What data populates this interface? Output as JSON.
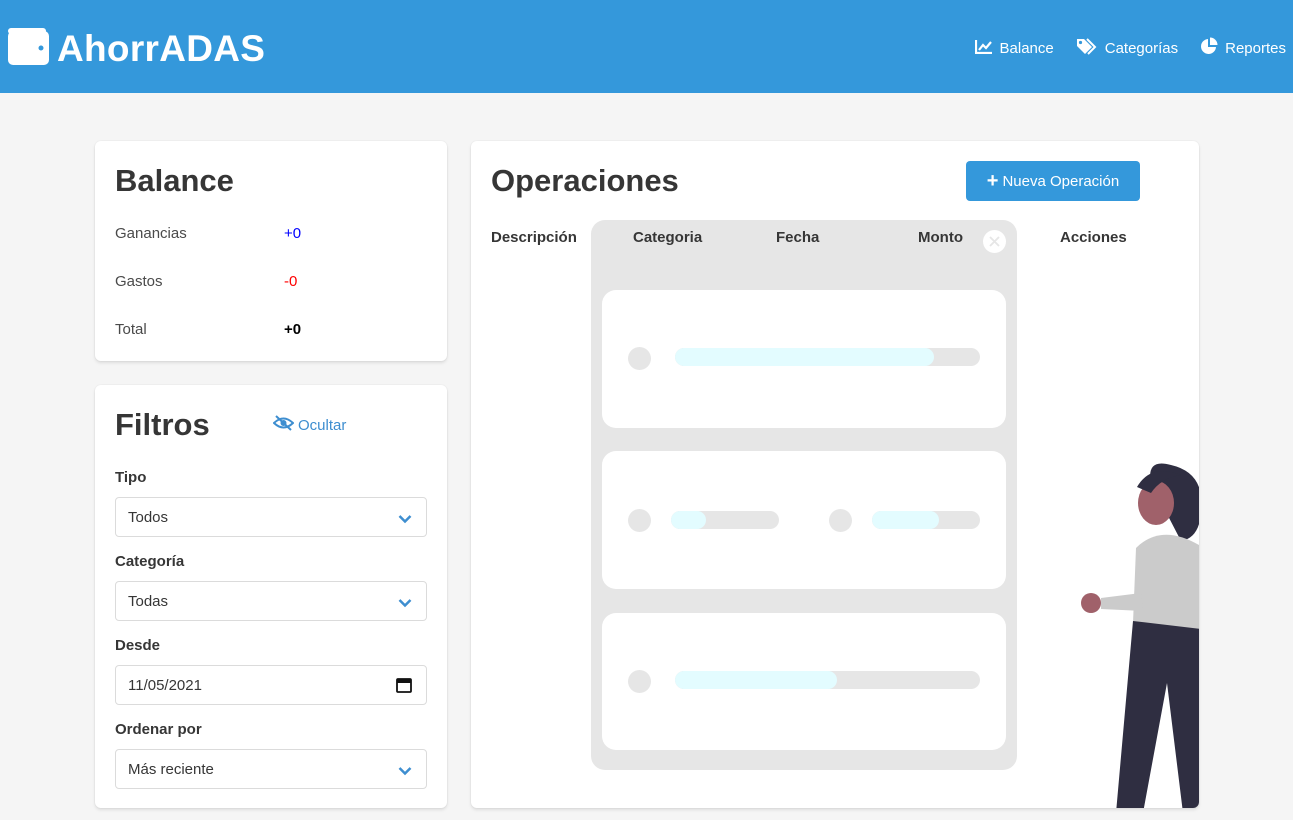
{
  "app": {
    "title": "AhorrADAS",
    "brand_color": "#3498db"
  },
  "nav": {
    "items": [
      {
        "label": "Balance",
        "icon": "chart-line-icon"
      },
      {
        "label": "Categorías",
        "icon": "tags-icon"
      },
      {
        "label": "Reportes",
        "icon": "pie-chart-icon"
      }
    ]
  },
  "balance": {
    "title": "Balance",
    "rows": [
      {
        "label": "Ganancias",
        "value": "+0",
        "color": "#0000ff"
      },
      {
        "label": "Gastos",
        "value": "-0",
        "color": "#ff0000"
      },
      {
        "label": "Total",
        "value": "+0",
        "color": "#000000"
      }
    ]
  },
  "filters": {
    "title": "Filtros",
    "hide_label": "Ocultar",
    "tipo": {
      "label": "Tipo",
      "value": "Todos"
    },
    "categoria": {
      "label": "Categoría",
      "value": "Todas"
    },
    "desde": {
      "label": "Desde",
      "value": "11/05/2021"
    },
    "ordenar": {
      "label": "Ordenar por",
      "value": "Más reciente"
    }
  },
  "operations": {
    "title": "Operaciones",
    "new_button": "Nueva Operación",
    "columns": [
      "Descripción",
      "Categoria",
      "Fecha",
      "Monto",
      "Acciones"
    ],
    "illustration": {
      "cards": [
        {
          "bars": [
            {
              "fill": 0.85
            }
          ]
        },
        {
          "bars": [
            {
              "fill": 0.32
            },
            {
              "fill": 0.62
            }
          ]
        },
        {
          "bars": [
            {
              "fill": 0.53
            }
          ]
        }
      ]
    }
  }
}
